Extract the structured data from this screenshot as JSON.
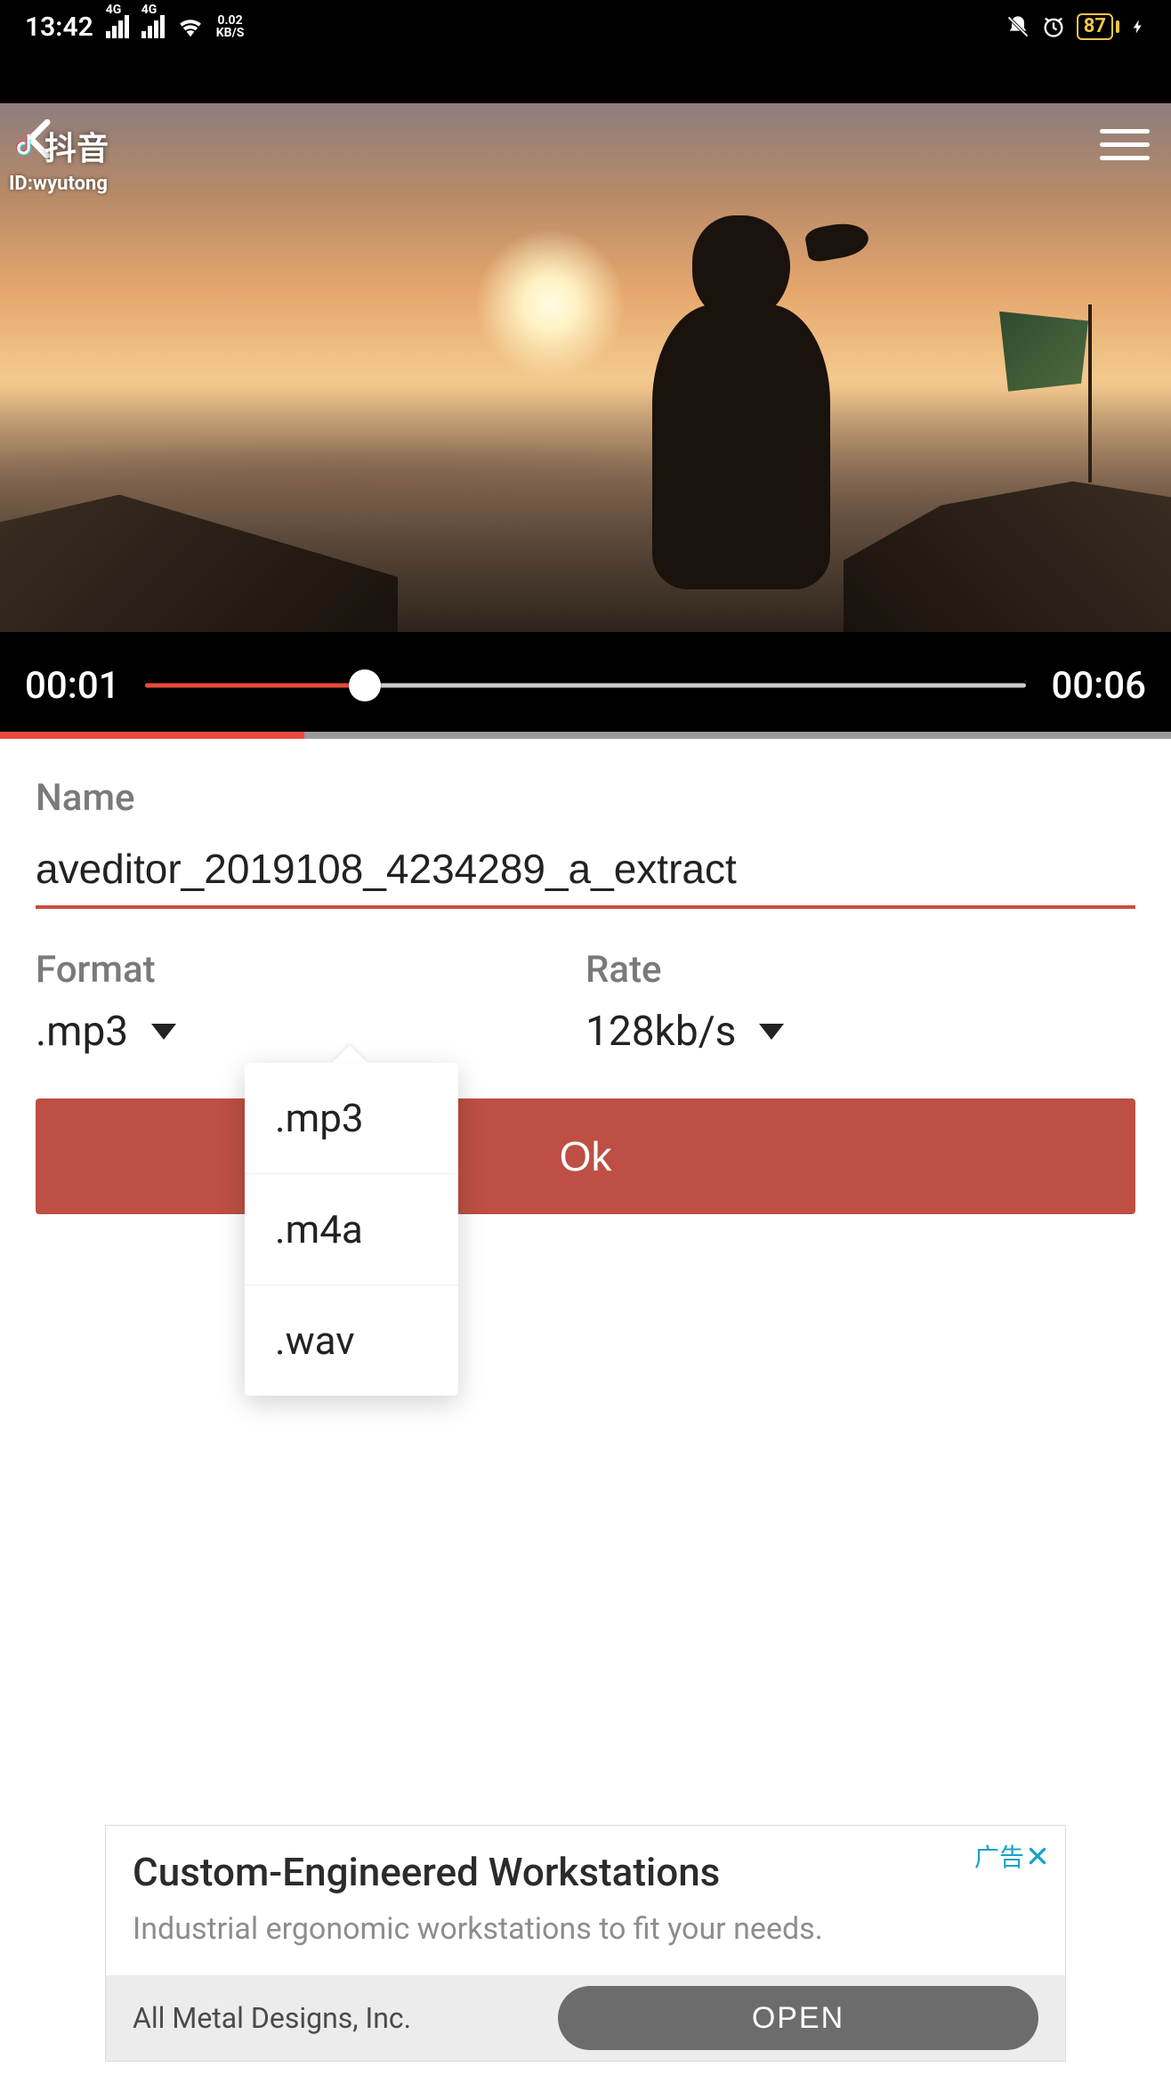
{
  "status": {
    "time": "13:42",
    "net_label": "4G",
    "kbps_top": "0.02",
    "kbps_bottom": "KB/S",
    "battery": "87"
  },
  "video": {
    "watermark_app": "抖音",
    "watermark_id": "ID:wyutong",
    "current_time": "00:01",
    "total_time": "00:06",
    "progress_pct": 25,
    "buffer_pct": 26
  },
  "form": {
    "name_label": "Name",
    "name_value": "aveditor_2019108_4234289_a_extract",
    "format_label": "Format",
    "format_value": ".mp3",
    "rate_label": "Rate",
    "rate_value": "128kb/s",
    "ok_label": "Ok",
    "format_options": [
      ".mp3",
      ".m4a",
      ".wav"
    ]
  },
  "ad": {
    "corner": "广告",
    "title": "Custom-Engineered Workstations",
    "subtitle": "Industrial ergonomic workstations to fit your needs.",
    "company": "All Metal Designs, Inc.",
    "open": "OPEN"
  }
}
